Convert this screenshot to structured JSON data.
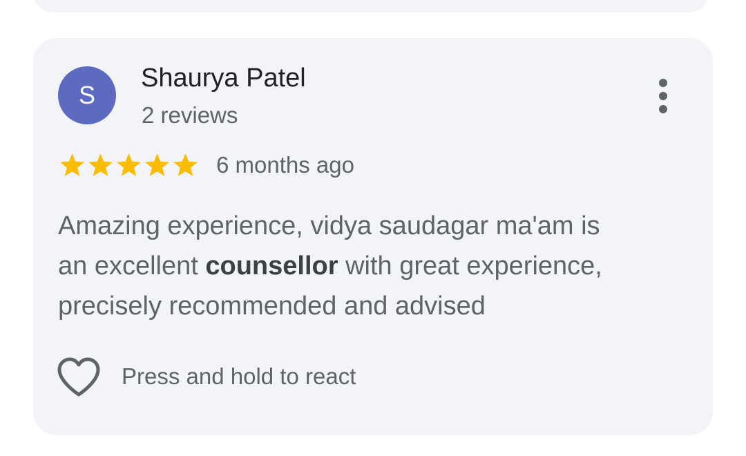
{
  "review": {
    "author_initial": "S",
    "author_name": "Shaurya Patel",
    "author_reviews": "2 reviews",
    "rating": 5,
    "rating_max": 5,
    "time_ago": "6 months ago",
    "text_line1": "Amazing experience, vidya saudagar ma'am is",
    "text_line2_pre": "an excellent ",
    "text_line2_bold": "counsellor",
    "text_line2_post": " with great experience,",
    "text_line3": "precisely recommended and advised",
    "react_label": "Press and hold to react",
    "more_icon": "more-vert-icon",
    "react_icon": "heart-outline-icon"
  },
  "colors": {
    "card_background": "#f3f4f7",
    "avatar_background": "#5c6bc0",
    "star": "#fbbc04",
    "text_primary": "#202124",
    "text_secondary": "#5f6368"
  }
}
